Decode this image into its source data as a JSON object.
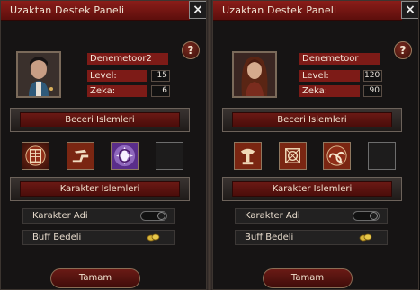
{
  "panels": [
    {
      "title": "Uzaktan Destek Paneli",
      "close_icon": "×",
      "help_icon": "?",
      "character": {
        "name": "Denemetoor2",
        "level_label": "Level:",
        "level_value": "15",
        "zeka_label": "Zeka:",
        "zeka_value": "6"
      },
      "skills_section": "Beceri Islemleri",
      "character_section": "Karakter Islemleri",
      "options": {
        "character_name": "Karakter Adi",
        "buff_cost": "Buff Bedeli"
      },
      "ok_button": "Tamam"
    },
    {
      "title": "Uzaktan Destek Paneli",
      "close_icon": "×",
      "help_icon": "?",
      "character": {
        "name": "Denemetoor",
        "level_label": "Level:",
        "level_value": "120",
        "zeka_label": "Zeka:",
        "zeka_value": "90"
      },
      "skills_section": "Beceri Islemleri",
      "character_section": "Karakter Islemleri",
      "options": {
        "character_name": "Karakter Adi",
        "buff_cost": "Buff Bedeli"
      },
      "ok_button": "Tamam"
    }
  ],
  "colors": {
    "title_bar": "#7d1b17",
    "accent_red": "#6a1914",
    "frame": "#6c625a",
    "background": "#161414"
  }
}
